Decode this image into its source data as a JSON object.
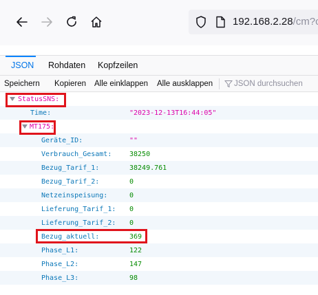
{
  "browser": {
    "url_main": "192.168.2.28",
    "url_rest": "/cm?cm",
    "icons": {
      "back": "back-arrow-icon",
      "forward": "forward-arrow-icon",
      "reload": "reload-icon",
      "home": "home-icon",
      "shield": "shield-icon",
      "page": "page-icon"
    }
  },
  "viewer": {
    "tabs": [
      "JSON",
      "Rohdaten",
      "Kopfzeilen"
    ],
    "active_tab": "JSON",
    "actions": [
      "Speichern",
      "Kopieren",
      "Alle einklappen",
      "Alle ausklappen"
    ],
    "filter_placeholder": "JSON durchsuchen"
  },
  "json": {
    "root_key": "StatusSNS:",
    "time_key": "Time:",
    "time_value": "\"2023-12-13T16:44:05\"",
    "meter_key": "MT175:",
    "fields": [
      {
        "key": "Geräte_ID:",
        "value": "\"\"",
        "type": "string"
      },
      {
        "key": "Verbrauch_Gesamt:",
        "value": "38250",
        "type": "number"
      },
      {
        "key": "Bezug_Tarif_1:",
        "value": "38249.761",
        "type": "number"
      },
      {
        "key": "Bezug_Tarif_2:",
        "value": "0",
        "type": "number"
      },
      {
        "key": "Netzeinspeisung:",
        "value": "0",
        "type": "number"
      },
      {
        "key": "Lieferung_Tarif_1:",
        "value": "0",
        "type": "number"
      },
      {
        "key": "Lieferung_Tarif_2:",
        "value": "0",
        "type": "number"
      },
      {
        "key": "Bezug_aktuell:",
        "value": "369",
        "type": "number"
      },
      {
        "key": "Phase_L1:",
        "value": "122",
        "type": "number"
      },
      {
        "key": "Phase_L2:",
        "value": "147",
        "type": "number"
      },
      {
        "key": "Phase_L3:",
        "value": "98",
        "type": "number"
      }
    ]
  },
  "colors": {
    "highlight": "#e0141c",
    "key": "#0b77b8",
    "string": "#dd00a9",
    "number": "#058b00",
    "accent": "#0a84ff"
  }
}
